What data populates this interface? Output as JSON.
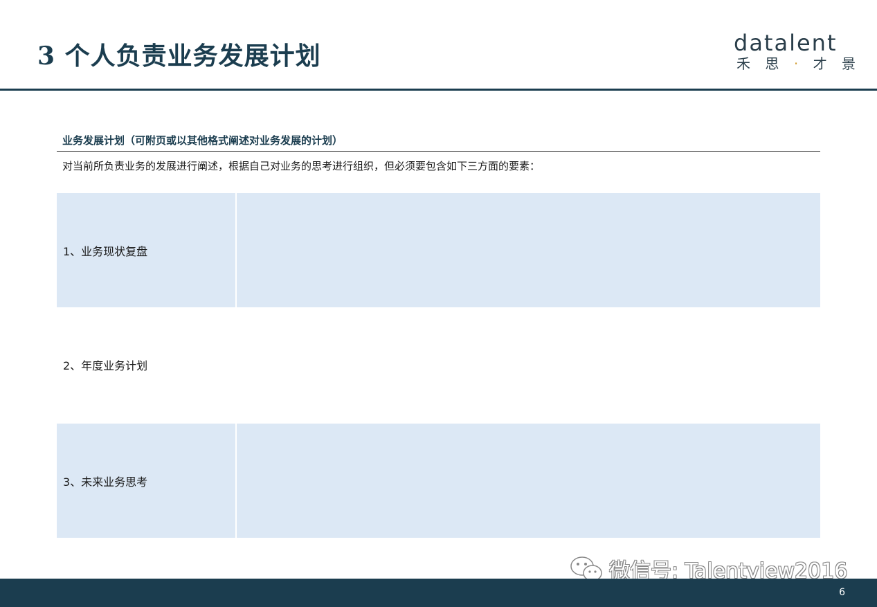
{
  "header": {
    "title": "3 个人负责业务发展计划",
    "logo": {
      "word": "datalent",
      "sub": [
        "禾",
        "思",
        "·",
        "才",
        "景"
      ]
    }
  },
  "section": {
    "heading": "业务发展计划（可附页或以其他格式阐述对业务发展的计划）",
    "instructions": "对当前所负责业务的发展进行阐述，根据自己对业务的思考进行组织，但必须要包含如下三方面的要素："
  },
  "rows": [
    {
      "label": "1、业务现状复盘",
      "content": ""
    },
    {
      "label": "2、年度业务计划",
      "content": ""
    },
    {
      "label": "3、未来业务思考",
      "content": ""
    }
  ],
  "watermark": {
    "text": "微信号: Talentview2016",
    "icon": "wechat-icon"
  },
  "footer": {
    "page_number": "6"
  },
  "colors": {
    "primary": "#1b3d4f",
    "row_fill": "#dce8f5",
    "logo_dot": "#d4a13a"
  }
}
